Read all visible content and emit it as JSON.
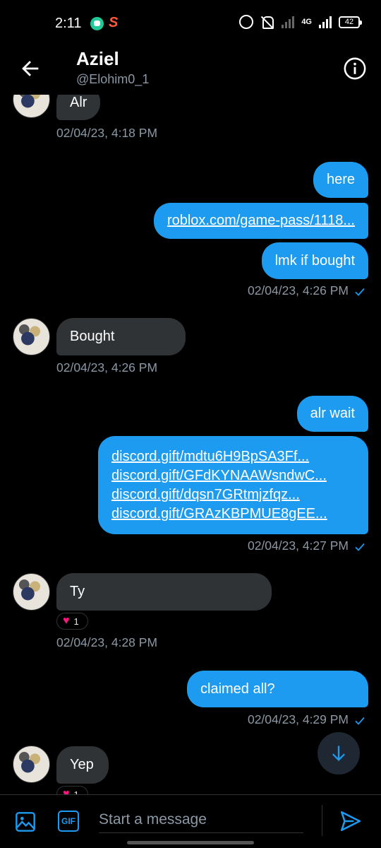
{
  "status_bar": {
    "time": "2:11",
    "network": "4G",
    "battery": "42"
  },
  "header": {
    "name": "Aziel",
    "handle": "@Elohim0_1"
  },
  "messages": {
    "m1": {
      "text": "Alr",
      "time": "02/04/23, 4:18 PM"
    },
    "m2": {
      "text": "here"
    },
    "m3": {
      "text": "roblox.com/game-pass/1118..."
    },
    "m4": {
      "text": "lmk if bought",
      "time": "02/04/23, 4:26 PM"
    },
    "m5": {
      "text": "Bought",
      "time": "02/04/23, 4:26 PM"
    },
    "m6": {
      "text": "alr wait"
    },
    "m7": {
      "lines": [
        "discord.gift/mdtu6H9BpSA3Ff...",
        "discord.gift/GFdKYNAAWsndwC...",
        "discord.gift/dqsn7GRtmjzfqz...",
        "discord.gift/GRAzKBPMUE8gEE..."
      ],
      "time": "02/04/23, 4:27 PM"
    },
    "m8": {
      "text": "Ty",
      "reaction_count": "1",
      "time": "02/04/23, 4:28 PM"
    },
    "m9": {
      "text": "claimed all?",
      "time": "02/04/23, 4:29 PM"
    },
    "m10": {
      "text": "Yep",
      "reaction_count": "1"
    }
  },
  "compose": {
    "placeholder": "Start a message",
    "gif_label": "GIF"
  },
  "colors": {
    "accent": "#1d9bf0",
    "incoming_bubble": "#2f3336",
    "heart": "#f91880"
  }
}
